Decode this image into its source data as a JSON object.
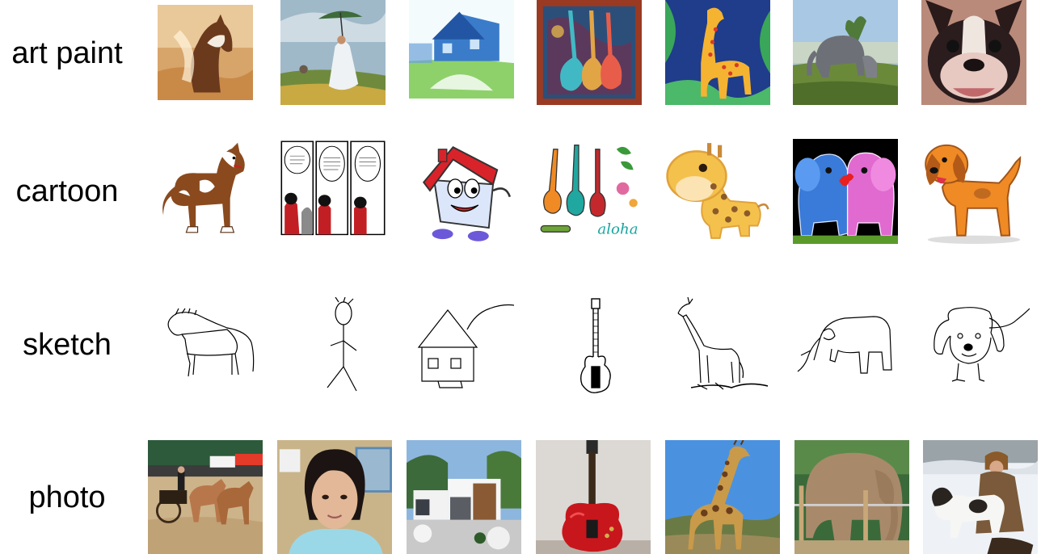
{
  "rows": [
    {
      "label": "art paint",
      "items": [
        {
          "subject": "horse",
          "icon": "horse-painting-icon"
        },
        {
          "subject": "person",
          "icon": "woman-umbrella-painting-icon"
        },
        {
          "subject": "house",
          "icon": "house-painting-icon"
        },
        {
          "subject": "guitar",
          "icon": "guitars-painting-icon"
        },
        {
          "subject": "giraffe",
          "icon": "giraffe-painting-icon"
        },
        {
          "subject": "elephant",
          "icon": "elephant-painting-icon"
        },
        {
          "subject": "dog",
          "icon": "dog-painting-icon"
        }
      ]
    },
    {
      "label": "cartoon",
      "items": [
        {
          "subject": "horse",
          "icon": "cartoon-horse-icon"
        },
        {
          "subject": "person",
          "icon": "comic-strip-icon"
        },
        {
          "subject": "house",
          "icon": "cartoon-house-icon"
        },
        {
          "subject": "guitar",
          "icon": "cartoon-guitars-icon"
        },
        {
          "subject": "giraffe",
          "icon": "cartoon-giraffe-icon"
        },
        {
          "subject": "elephant",
          "icon": "cartoon-elephants-icon"
        },
        {
          "subject": "dog",
          "icon": "cartoon-dog-icon"
        }
      ]
    },
    {
      "label": "sketch",
      "items": [
        {
          "subject": "horse",
          "icon": "horse-sketch-icon"
        },
        {
          "subject": "person",
          "icon": "stick-figure-sketch-icon"
        },
        {
          "subject": "house",
          "icon": "house-sketch-icon"
        },
        {
          "subject": "guitar",
          "icon": "guitar-sketch-icon"
        },
        {
          "subject": "giraffe",
          "icon": "giraffe-sketch-icon"
        },
        {
          "subject": "elephant",
          "icon": "elephant-sketch-icon"
        },
        {
          "subject": "dog",
          "icon": "dog-sketch-icon"
        }
      ]
    },
    {
      "label": "photo",
      "items": [
        {
          "subject": "horse",
          "icon": "horse-carriage-photo-icon"
        },
        {
          "subject": "person",
          "icon": "portrait-photo-icon"
        },
        {
          "subject": "house",
          "icon": "modern-house-photo-icon"
        },
        {
          "subject": "guitar",
          "icon": "red-guitar-photo-icon"
        },
        {
          "subject": "giraffe",
          "icon": "giraffe-photo-icon"
        },
        {
          "subject": "elephant",
          "icon": "elephant-photo-icon"
        },
        {
          "subject": "dog",
          "icon": "dog-snow-photo-icon"
        }
      ]
    }
  ],
  "colors": {
    "text": "#000000",
    "background": "#ffffff",
    "sky": "#7ab6e8",
    "grass": "#5a8a3a",
    "cartoon_orange": "#f08a24",
    "guitar_red": "#c8161d"
  }
}
